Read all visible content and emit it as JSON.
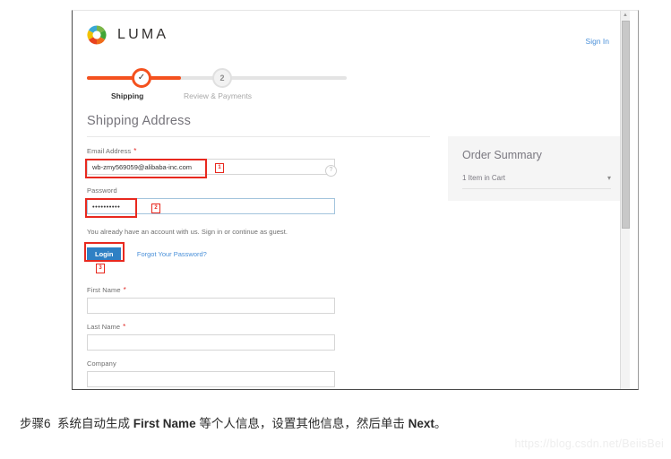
{
  "header": {
    "brand": "LUMA",
    "signin_label": "Sign In",
    "logo_icon": "luma-ring-logo",
    "colors": {
      "orange": "#f4511e",
      "green": "#7ab648",
      "blue": "#3aa9d6",
      "yellow": "#f2c200",
      "link": "#4a90d9"
    }
  },
  "progress": {
    "step1": {
      "label": "Shipping",
      "marker": "check-icon",
      "state": "complete"
    },
    "step2": {
      "label": "Review & Payments",
      "marker": "2",
      "state": "upcoming"
    }
  },
  "main": {
    "section_title": "Shipping Address",
    "fields": {
      "email": {
        "label": "Email Address",
        "required": "*",
        "value": "wb-zmy569059@alibaba-inc.com",
        "placeholder": "",
        "help_icon": "question-mark-icon",
        "annotation": "1"
      },
      "password": {
        "label": "Password",
        "required": "",
        "value": "••••••••••",
        "placeholder": "",
        "annotation": "2"
      },
      "first_name": {
        "label": "First Name",
        "required": "*",
        "value": "",
        "placeholder": ""
      },
      "last_name": {
        "label": "Last Name",
        "required": "*",
        "value": "",
        "placeholder": ""
      },
      "company": {
        "label": "Company",
        "required": "",
        "value": "",
        "placeholder": ""
      }
    },
    "account_hint": "You already have an account with us. Sign in or continue as guest.",
    "login_button": "Login",
    "login_annotation": "3",
    "forgot_link": "Forgot Your Password?"
  },
  "order_summary": {
    "title": "Order Summary",
    "cart_label": "1 Item in Cart",
    "chevron": "chevron-down-icon"
  },
  "scrollbar": {
    "up_arrow": "▲"
  },
  "caption": {
    "prefix": "步骤6",
    "text_1": "系统自动生成 ",
    "bold_1": "First Name",
    "text_2": " 等个人信息，设置其他信息，然后单击 ",
    "bold_2": "Next",
    "text_3": "。"
  },
  "watermark": "https://blog.csdn.net/BeiisBei"
}
